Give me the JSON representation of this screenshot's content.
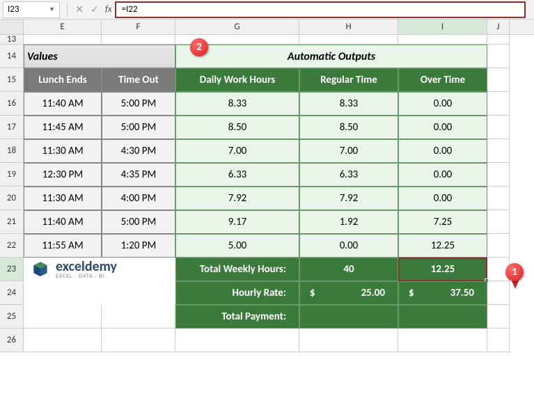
{
  "nameBox": "I23",
  "formula": "=I22",
  "columns": [
    "E",
    "F",
    "G",
    "H",
    "I",
    "J"
  ],
  "rows": [
    "13",
    "14",
    "15",
    "16",
    "17",
    "18",
    "19",
    "20",
    "21",
    "22",
    "23",
    "24",
    "25",
    "26"
  ],
  "sections": {
    "values": "Values",
    "outputs": "Automatic Outputs"
  },
  "headers": {
    "lunchEnds": "Lunch Ends",
    "timeOut": "Time Out",
    "dailyHours": "Daily Work Hours",
    "regularTime": "Regular Time",
    "overTime": "Over Time"
  },
  "data": [
    {
      "lunch": "11:40 AM",
      "out": "5:00 PM",
      "daily": "8.33",
      "reg": "8.33",
      "ot": "0.00"
    },
    {
      "lunch": "11:45 AM",
      "out": "5:00 PM",
      "daily": "8.50",
      "reg": "8.50",
      "ot": "0.00"
    },
    {
      "lunch": "11:30 AM",
      "out": "4:30 PM",
      "daily": "7.00",
      "reg": "7.00",
      "ot": "0.00"
    },
    {
      "lunch": "12:30 PM",
      "out": "4:35 PM",
      "daily": "6.33",
      "reg": "6.33",
      "ot": "0.00"
    },
    {
      "lunch": "11:30 AM",
      "out": "4:00 PM",
      "daily": "7.92",
      "reg": "7.92",
      "ot": "0.00"
    },
    {
      "lunch": "11:40 AM",
      "out": "5:00 PM",
      "daily": "9.17",
      "reg": "1.92",
      "ot": "7.25"
    },
    {
      "lunch": "11:55 AM",
      "out": "1:20 PM",
      "daily": "5.00",
      "reg": "0.00",
      "ot": "12.25"
    }
  ],
  "summary": {
    "totalWeeklyLabel": "Total Weekly Hours:",
    "totalWeeklyReg": "40",
    "totalWeeklyOT": "12.25",
    "hourlyRateLabel": "Hourly Rate:",
    "hourlyRateReg": "25.00",
    "hourlyRateOT": "37.50",
    "totalPaymentLabel": "Total Payment:",
    "dollar": "$"
  },
  "logo": {
    "main": "exceldemy",
    "sub": "EXCEL · DATA · BI"
  },
  "callouts": {
    "c1": "1",
    "c2": "2"
  },
  "chart_data": {
    "type": "table",
    "title": "Automatic Outputs",
    "columns": [
      "Lunch Ends",
      "Time Out",
      "Daily Work Hours",
      "Regular Time",
      "Over Time"
    ],
    "rows": [
      [
        "11:40 AM",
        "5:00 PM",
        8.33,
        8.33,
        0.0
      ],
      [
        "11:45 AM",
        "5:00 PM",
        8.5,
        8.5,
        0.0
      ],
      [
        "11:30 AM",
        "4:30 PM",
        7.0,
        7.0,
        0.0
      ],
      [
        "12:30 PM",
        "4:35 PM",
        6.33,
        6.33,
        0.0
      ],
      [
        "11:30 AM",
        "4:00 PM",
        7.92,
        7.92,
        0.0
      ],
      [
        "11:40 AM",
        "5:00 PM",
        9.17,
        1.92,
        7.25
      ],
      [
        "11:55 AM",
        "1:20 PM",
        5.0,
        0.0,
        12.25
      ]
    ],
    "totals": {
      "Total Weekly Hours": {
        "Regular": 40,
        "Over Time": 12.25
      },
      "Hourly Rate": {
        "Regular": 25.0,
        "Over Time": 37.5
      }
    }
  }
}
